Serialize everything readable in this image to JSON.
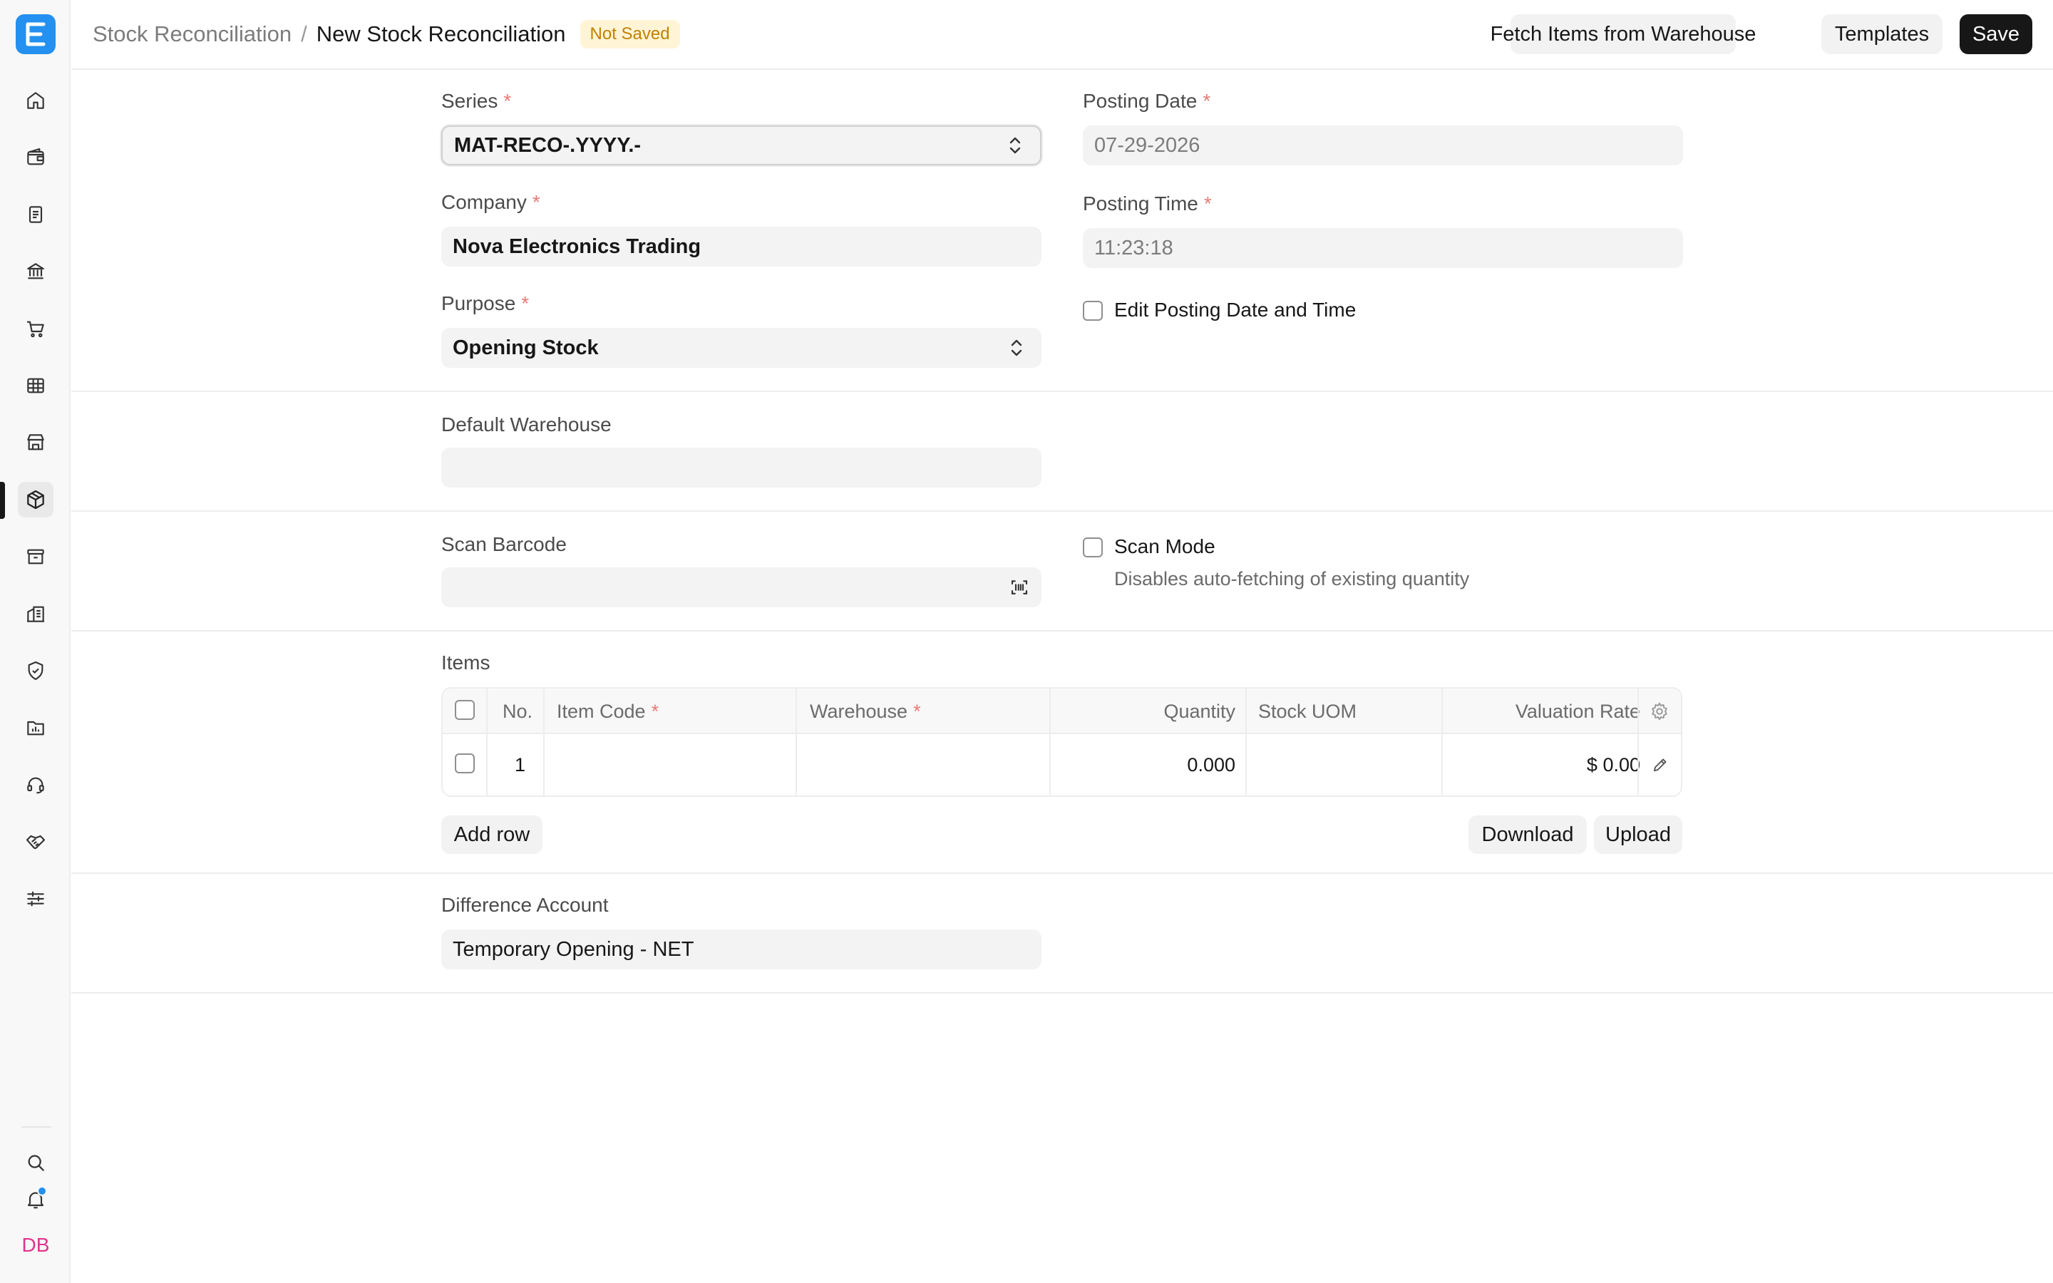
{
  "sidebar": {
    "logo_letter": "E",
    "avatar_initials": "DB",
    "items": [
      {
        "name": "home-icon"
      },
      {
        "name": "wallet-icon"
      },
      {
        "name": "invoice-icon"
      },
      {
        "name": "bank-icon"
      },
      {
        "name": "cart-icon"
      },
      {
        "name": "table-icon"
      },
      {
        "name": "store-icon"
      },
      {
        "name": "stock-box-icon",
        "active": true
      },
      {
        "name": "archive-icon"
      },
      {
        "name": "building-icon"
      },
      {
        "name": "shield-check-icon"
      },
      {
        "name": "folder-chart-icon"
      },
      {
        "name": "headset-icon"
      },
      {
        "name": "handshake-icon"
      },
      {
        "name": "sliders-icon"
      }
    ]
  },
  "header": {
    "parent": "Stock Reconciliation",
    "separator": "/",
    "title": "New Stock Reconciliation",
    "status": "Not Saved",
    "fetch_label": "Fetch Items from Warehouse",
    "templates_label": "Templates",
    "save_label": "Save"
  },
  "form": {
    "series": {
      "label": "Series",
      "value": "MAT-RECO-.YYYY.-"
    },
    "company": {
      "label": "Company",
      "value": "Nova Electronics Trading"
    },
    "purpose": {
      "label": "Purpose",
      "value": "Opening Stock"
    },
    "posting_date": {
      "label": "Posting Date",
      "value": "07-29-2026"
    },
    "posting_time": {
      "label": "Posting Time",
      "value": "11:23:18"
    },
    "edit_posting": {
      "label": "Edit Posting Date and Time"
    },
    "default_warehouse": {
      "label": "Default Warehouse",
      "value": ""
    },
    "scan_barcode": {
      "label": "Scan Barcode",
      "value": ""
    },
    "scan_mode": {
      "label": "Scan Mode",
      "description": "Disables auto-fetching of existing quantity"
    },
    "difference_account": {
      "label": "Difference Account",
      "value": "Temporary Opening - NET"
    }
  },
  "items": {
    "label": "Items",
    "columns": {
      "no": "No.",
      "item_code": "Item Code",
      "warehouse": "Warehouse",
      "quantity": "Quantity",
      "stock_uom": "Stock UOM",
      "valuation_rate": "Valuation Rate"
    },
    "rows": [
      {
        "no": "1",
        "item_code": "",
        "warehouse": "",
        "quantity": "0.000",
        "stock_uom": "",
        "valuation_rate": "$ 0.00"
      }
    ],
    "add_row_label": "Add row",
    "download_label": "Download",
    "upload_label": "Upload"
  },
  "required_mark": "*"
}
